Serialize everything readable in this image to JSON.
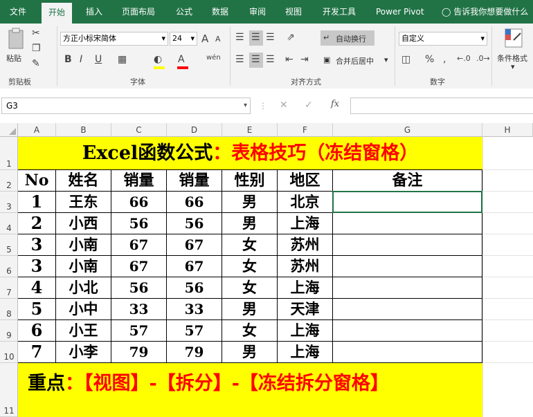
{
  "menu": {
    "tabs": [
      "文件",
      "开始",
      "插入",
      "页面布局",
      "公式",
      "数据",
      "审阅",
      "视图",
      "开发工具",
      "Power Pivot"
    ],
    "active_tab": "开始",
    "tell_me": "告诉我你想要做什么"
  },
  "ribbon": {
    "clipboard": {
      "label": "剪贴板",
      "paste_label": "粘贴"
    },
    "font": {
      "label": "字体",
      "font_name": "方正小标宋简体",
      "font_size": "24",
      "bold": "B",
      "italic": "I",
      "underline": "U",
      "grow": "A",
      "shrink": "A",
      "font_color_glyph": "A",
      "phonetic": "wén"
    },
    "alignment": {
      "label": "对齐方式",
      "wrap_text": "自动换行",
      "merge_center": "合并后居中"
    },
    "number": {
      "label": "数字",
      "format": "自定义",
      "percent": "%",
      "comma": ","
    },
    "styles": {
      "conditional": "条件格式"
    }
  },
  "formula_bar": {
    "name_box": "G3",
    "fx": "fx"
  },
  "sheet": {
    "columns": [
      "A",
      "B",
      "C",
      "D",
      "E",
      "F",
      "G",
      "H"
    ],
    "rows": [
      "1",
      "2",
      "3",
      "4",
      "5",
      "6",
      "7",
      "8",
      "9",
      "10",
      "11"
    ],
    "title_black": "Excel函数公式",
    "title_red": "：表格技巧（冻结窗格）",
    "headers": [
      "No",
      "姓名",
      "销量",
      "销量",
      "性别",
      "地区",
      "备注"
    ],
    "data": [
      [
        "1",
        "王东",
        "66",
        "66",
        "男",
        "北京",
        ""
      ],
      [
        "2",
        "小西",
        "56",
        "56",
        "男",
        "上海",
        ""
      ],
      [
        "3",
        "小南",
        "67",
        "67",
        "女",
        "苏州",
        ""
      ],
      [
        "3",
        "小南",
        "67",
        "67",
        "女",
        "苏州",
        ""
      ],
      [
        "4",
        "小北",
        "56",
        "56",
        "女",
        "上海",
        ""
      ],
      [
        "5",
        "小中",
        "33",
        "33",
        "男",
        "天津",
        ""
      ],
      [
        "6",
        "小王",
        "57",
        "57",
        "女",
        "上海",
        ""
      ],
      [
        "7",
        "小李",
        "79",
        "79",
        "男",
        "上海",
        ""
      ]
    ],
    "footer_black": "重点",
    "footer_red": "：【视图】-【拆分】-【冻结拆分窗格】"
  },
  "colors": {
    "excel_green": "#217346",
    "highlight_yellow": "#ffff00",
    "red_text": "#ff0000"
  }
}
